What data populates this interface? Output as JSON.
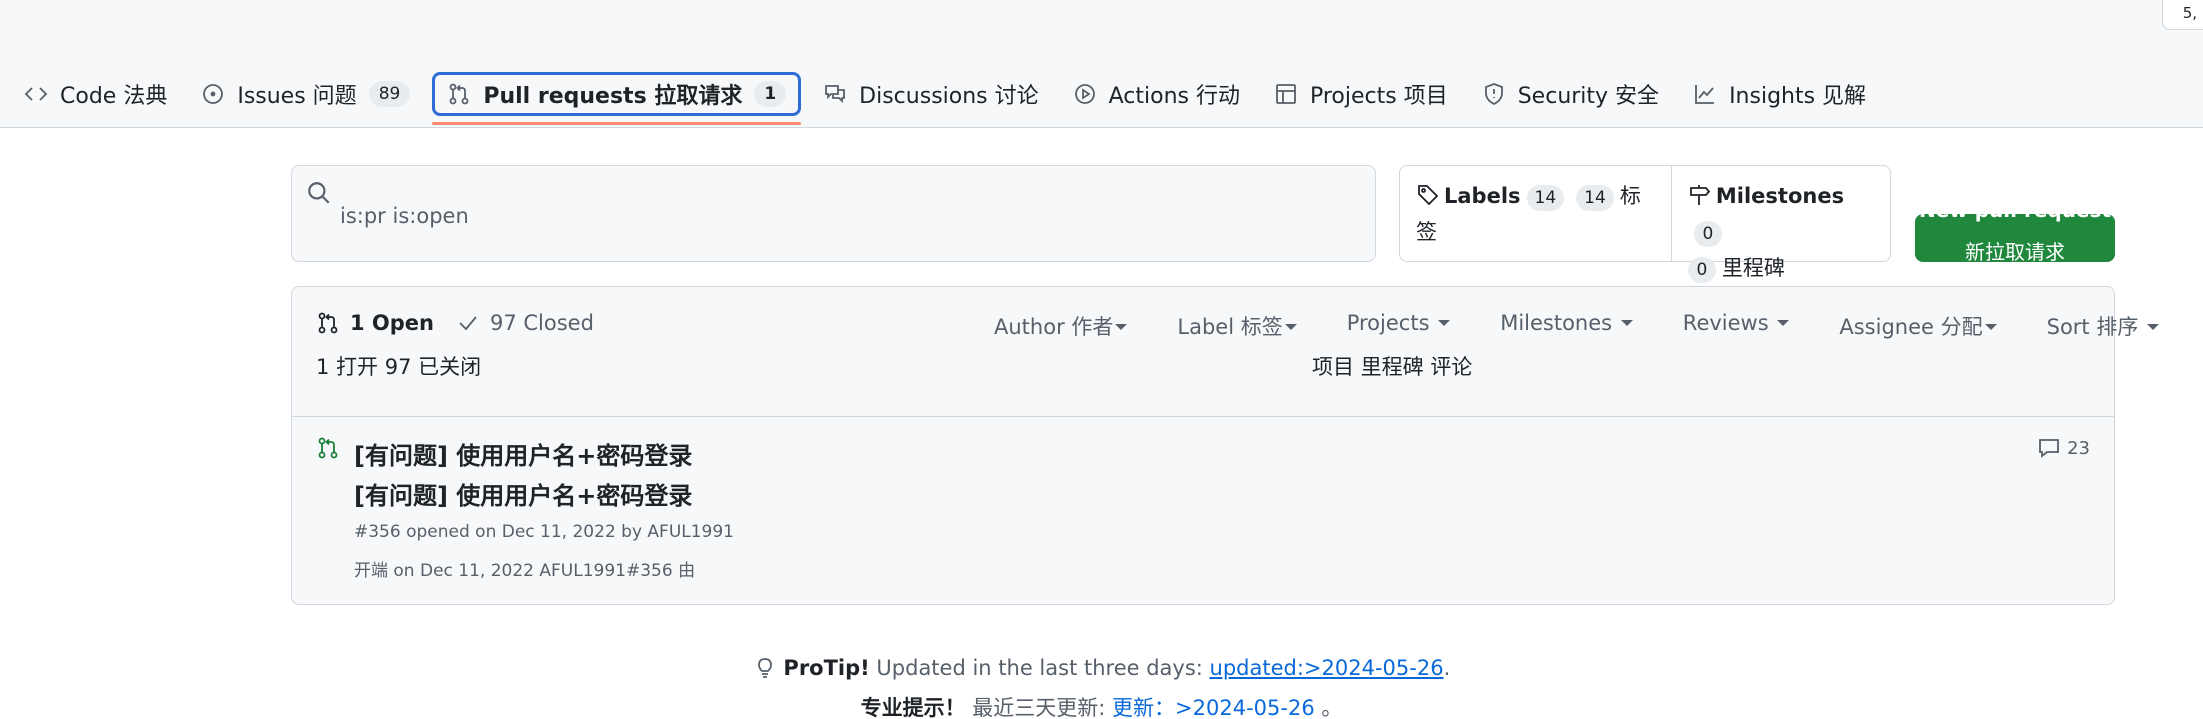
{
  "corner_badge": "5,",
  "tabs": [
    {
      "label": "Code 法典",
      "icon": "code-icon"
    },
    {
      "label": "Issues 问题",
      "icon": "issue-circle-icon",
      "count": "89"
    },
    {
      "label": "Pull requests 拉取请求",
      "icon": "git-pull-request-icon",
      "count": "1",
      "active": true
    },
    {
      "label": "Discussions 讨论",
      "icon": "comment-discussion-icon"
    },
    {
      "label": "Actions 行动",
      "icon": "play-icon"
    },
    {
      "label": "Projects 项目",
      "icon": "table-icon"
    },
    {
      "label": "Security 安全",
      "icon": "shield-icon"
    },
    {
      "label": "Insights 见解",
      "icon": "graph-icon"
    }
  ],
  "search": {
    "value": "is:pr is:open",
    "icon": "search-icon"
  },
  "labels": {
    "label": "Labels",
    "count": "14",
    "count_zh": "14",
    "label_zh": "标签"
  },
  "milestones": {
    "label": "Milestones",
    "count": "0",
    "count_zh": "0",
    "label_zh": "里程碑"
  },
  "new_pr": {
    "label": "New pull request",
    "label_zh": "新拉取请求",
    "color": "#1f883d"
  },
  "states": {
    "open": "1 Open",
    "closed": "97 Closed",
    "zh": "1 打开 97 已关闭"
  },
  "filters": [
    {
      "label": "Author  作者"
    },
    {
      "label": "Label  标签"
    },
    {
      "label": "Projects"
    },
    {
      "label": "Milestones"
    },
    {
      "label": "Reviews"
    },
    {
      "label": "Assignee  分配"
    },
    {
      "label": "Sort 排序"
    }
  ],
  "filters_zh": "项目 里程碑 评论",
  "pull_request": {
    "title": "[有问题] 使用用户名+密码登录",
    "title_zh": "[有问题] 使用用户名+密码登录",
    "meta": "#356 opened on Dec 11, 2022 by AFUL1991",
    "meta_zh": "开端 on Dec 11, 2022 AFUL1991#356 由",
    "comments": "23"
  },
  "protip": {
    "label": "ProTip!",
    "text": " Updated in the last three days: ",
    "link": "updated:>2024-05-26",
    "end": ".",
    "label_zh": "专业提示！",
    "text_zh": " 最近三天更新: ",
    "link_zh": "更新：>2024-05-26",
    "end_zh": " 。"
  },
  "colors": {
    "accent": "#2f6cd6",
    "underline": "#fd8c73",
    "open_green": "#1a7f37",
    "link": "#0969da"
  }
}
